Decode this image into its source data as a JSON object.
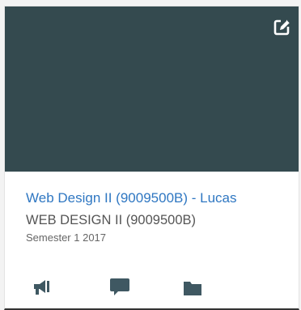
{
  "colors": {
    "hero": "#344a4f",
    "link": "#2f77c2",
    "code_text": "#555555",
    "term_text": "#666666",
    "icon": "#3f5862",
    "edit_icon": "#ffffff"
  },
  "card": {
    "title_link": "Web Design II (9009500B) - Lucas",
    "course_code": "WEB DESIGN II (9009500B)",
    "term": "Semester 1 2017",
    "hero_icon": "edit-icon",
    "actions": [
      {
        "icon": "announcements-icon"
      },
      {
        "icon": "discussions-icon"
      },
      {
        "icon": "files-icon"
      }
    ]
  }
}
